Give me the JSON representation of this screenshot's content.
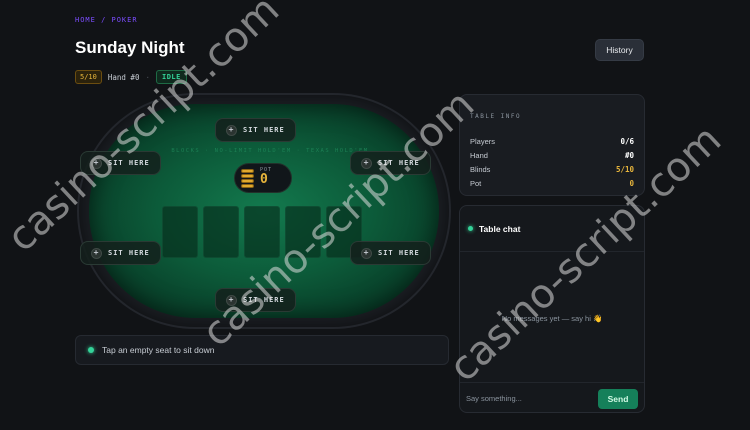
{
  "breadcrumb": "HOME / POKER",
  "title": "Sunday Night",
  "history_label": "History",
  "meta": {
    "stakes": "5/10",
    "hand": "Hand #0",
    "separator": "·",
    "state": "IDLE"
  },
  "table": {
    "felt_text": "BLOCKS · NO-LIMIT HOLD'EM · TEXAS HOLD'EM",
    "pot_label": "POT",
    "pot_value": "0",
    "seats": [
      {
        "label": "SIT HERE"
      },
      {
        "label": "SIT HERE"
      },
      {
        "label": "SIT HERE"
      },
      {
        "label": "SIT HERE"
      },
      {
        "label": "SIT HERE"
      },
      {
        "label": "SIT HERE"
      }
    ]
  },
  "status_message": "Tap an empty seat to sit down",
  "info": {
    "title": "TABLE INFO",
    "rows": [
      {
        "label": "Players",
        "value": "0/6"
      },
      {
        "label": "Hand",
        "value": "#0"
      },
      {
        "label": "Blinds",
        "value": "5/10"
      },
      {
        "label": "Pot",
        "value": "0"
      }
    ]
  },
  "chat": {
    "title": "Table chat",
    "empty": "No messages yet — say hi 👋",
    "placeholder": "Say something...",
    "send_label": "Send"
  },
  "watermark": "casino-script.com",
  "colors": {
    "accent_green": "#34d399",
    "accent_amber": "#e7b53c",
    "breadcrumb": "#7c4dff",
    "send_button": "#15805a"
  }
}
